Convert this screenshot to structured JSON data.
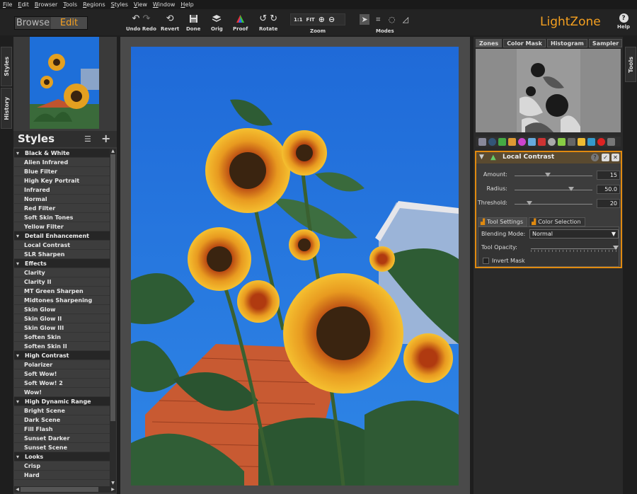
{
  "menu": [
    "File",
    "Edit",
    "Browser",
    "Tools",
    "Regions",
    "Styles",
    "View",
    "Window",
    "Help"
  ],
  "mode_switch": {
    "browse": "Browse",
    "edit": "Edit"
  },
  "toolbar": {
    "undo_redo": "Undo Redo",
    "revert": "Revert",
    "done": "Done",
    "orig": "Orig",
    "proof": "Proof",
    "rotate": "Rotate",
    "zoom": "Zoom",
    "zoom_1to1": "1:1",
    "zoom_fit": "FIT",
    "modes": "Modes",
    "help": "Help",
    "brand": "LightZone"
  },
  "left_tabs": {
    "styles": "Styles",
    "history": "History"
  },
  "right_tabs": {
    "tools": "Tools"
  },
  "styles_panel": {
    "title": "Styles",
    "groups": [
      {
        "name": "Black & White",
        "items": [
          "Alien Infrared",
          "Blue Filter",
          "High Key Portrait",
          "Infrared",
          "Normal",
          "Red Filter",
          "Soft Skin Tones",
          "Yellow Filter"
        ]
      },
      {
        "name": "Detail Enhancement",
        "items": [
          "Local Contrast",
          "SLR Sharpen"
        ]
      },
      {
        "name": "Effects",
        "items": [
          "Clarity",
          "Clarity II",
          "MT Green Sharpen",
          "Midtones Sharpening",
          "Skin Glow",
          "Skin Glow II",
          "Skin Glow III",
          "Soften Skin",
          "Soften Skin II"
        ]
      },
      {
        "name": "High Contrast",
        "items": [
          "Polarizer",
          "Soft Wow!",
          "Soft Wow! 2",
          "Wow!"
        ]
      },
      {
        "name": "High Dynamic Range",
        "items": [
          "Bright Scene",
          "Dark Scene",
          "Fill Flash",
          "Sunset Darker",
          "Sunset Scene"
        ]
      },
      {
        "name": "Looks",
        "items": [
          "Crisp",
          "Hard"
        ]
      }
    ]
  },
  "info_tabs": [
    "Zones",
    "Color Mask",
    "Histogram",
    "Sampler"
  ],
  "tool": {
    "title": "Local Contrast",
    "sliders": [
      {
        "label": "Amount:",
        "value": "15",
        "pos": 0.43
      },
      {
        "label": "Radius:",
        "value": "50.0",
        "pos": 0.73
      },
      {
        "label": "Threshold:",
        "value": "20",
        "pos": 0.19
      }
    ],
    "tabs": [
      "Tool Settings",
      "Color Selection"
    ],
    "blending_label": "Blending Mode:",
    "blending_value": "Normal",
    "opacity_label": "Tool Opacity:",
    "opacity_pos": 0.98,
    "invert_label": "Invert Mask"
  },
  "colors": {
    "accent": "#f5a020",
    "tool_border": "#e08a10",
    "sky": "#1e6fd9"
  }
}
